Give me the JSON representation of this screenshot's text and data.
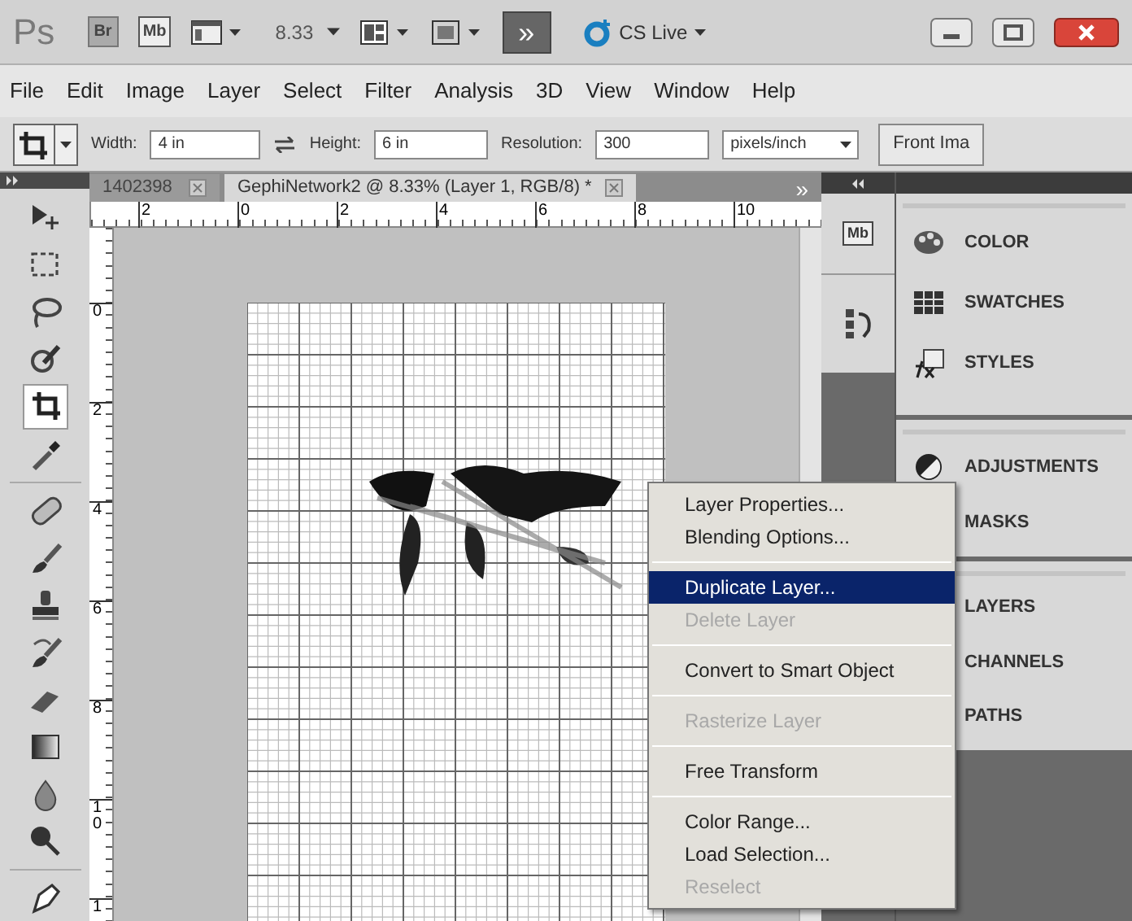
{
  "app_bar": {
    "logo": "Ps",
    "bridge": "Br",
    "mini_bridge": "Mb",
    "zoom": "8.33",
    "extensions": "»",
    "cs_live": "CS Live"
  },
  "menu_bar": [
    "File",
    "Edit",
    "Image",
    "Layer",
    "Select",
    "Filter",
    "Analysis",
    "3D",
    "View",
    "Window",
    "Help"
  ],
  "options_bar": {
    "width_label": "Width:",
    "width_value": "4 in",
    "height_label": "Height:",
    "height_value": "6 in",
    "resolution_label": "Resolution:",
    "resolution_value": "300",
    "unit": "pixels/inch",
    "front_image": "Front Ima"
  },
  "tools": [
    {
      "kind": "move",
      "selected": false
    },
    {
      "kind": "marquee",
      "selected": false
    },
    {
      "kind": "lasso",
      "selected": false
    },
    {
      "kind": "quick",
      "selected": false
    },
    {
      "kind": "crop",
      "selected": true
    },
    {
      "kind": "eyedropper",
      "selected": false
    },
    {
      "kind": "heal",
      "selected": false
    },
    {
      "kind": "brush",
      "selected": false
    },
    {
      "kind": "stamp",
      "selected": false
    },
    {
      "kind": "history",
      "selected": false
    },
    {
      "kind": "eraser",
      "selected": false
    },
    {
      "kind": "gradient",
      "selected": false
    },
    {
      "kind": "blur",
      "selected": false
    },
    {
      "kind": "dodge",
      "selected": false
    },
    {
      "kind": "pen",
      "selected": false
    }
  ],
  "document_tabs": [
    {
      "label": "1402398",
      "selected": false
    },
    {
      "label": "GephiNetwork2 @ 8.33% (Layer 1, RGB/8) *",
      "selected": true
    }
  ],
  "tab_overflow": "»",
  "rulers": {
    "horizontal": [
      "2",
      "0",
      "2",
      "4",
      "6",
      "8",
      "10"
    ],
    "vertical": [
      "0",
      "2",
      "4",
      "6",
      "8",
      "10",
      "1"
    ]
  },
  "dock": {
    "mini_bridge": "Mb"
  },
  "panels": [
    {
      "items": [
        {
          "label": "COLOR",
          "kind": "color"
        },
        {
          "label": "SWATCHES",
          "kind": "swatches"
        },
        {
          "label": "STYLES",
          "kind": "styles"
        }
      ]
    },
    {
      "items": [
        {
          "label": "ADJUSTMENTS",
          "kind": "adjustments"
        },
        {
          "label": "MASKS",
          "kind": "masks"
        }
      ]
    },
    {
      "items": [
        {
          "label": "LAYERS",
          "kind": "layers"
        },
        {
          "label": "CHANNELS",
          "kind": "channels"
        },
        {
          "label": "PATHS",
          "kind": "paths"
        }
      ]
    }
  ],
  "context_menu": {
    "groups": [
      [
        {
          "label": "Layer Properties...",
          "selected": false,
          "disabled": false
        },
        {
          "label": "Blending Options...",
          "selected": false,
          "disabled": false
        }
      ],
      [
        {
          "label": "Duplicate Layer...",
          "selected": true,
          "disabled": false
        },
        {
          "label": "Delete Layer",
          "selected": false,
          "disabled": true
        }
      ],
      [
        {
          "label": "Convert to Smart Object",
          "selected": false,
          "disabled": false
        }
      ],
      [
        {
          "label": "Rasterize Layer",
          "selected": false,
          "disabled": true
        }
      ],
      [
        {
          "label": "Free Transform",
          "selected": false,
          "disabled": false
        }
      ],
      [
        {
          "label": "Color Range...",
          "selected": false,
          "disabled": false
        },
        {
          "label": "Load Selection...",
          "selected": false,
          "disabled": false
        },
        {
          "label": "Reselect",
          "selected": false,
          "disabled": true
        }
      ]
    ]
  }
}
